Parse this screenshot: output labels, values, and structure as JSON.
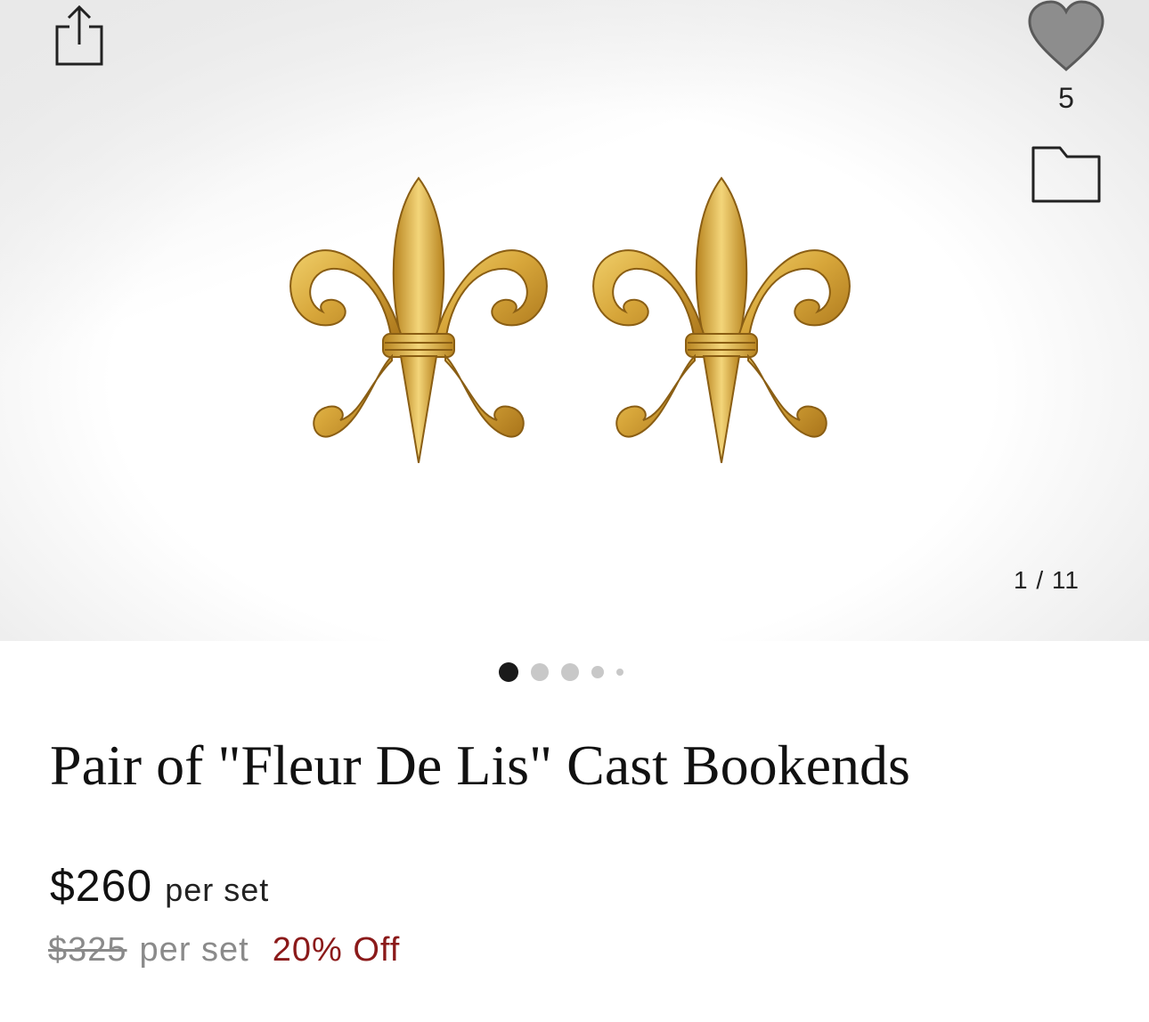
{
  "gallery": {
    "image_description_icon": "fleur-de-lis-bookends-photo",
    "counter": "1 / 11",
    "current_index": 1,
    "total_images": 11
  },
  "actions": {
    "share_icon": "share-icon",
    "favorite_icon": "heart-icon",
    "favorite_count": "5",
    "folder_icon": "folder-icon"
  },
  "product": {
    "title": "Pair of \"Fleur De Lis\" Cast Bookends",
    "price": "$260",
    "price_unit": "per set",
    "original_price": "$325",
    "original_unit": "per set",
    "discount": "20% Off"
  },
  "colors": {
    "discount": "#8b1a1a",
    "active_dot": "#1a1a1a",
    "inactive_dot": "#c8c8c8",
    "gold": "#c99a2e"
  }
}
